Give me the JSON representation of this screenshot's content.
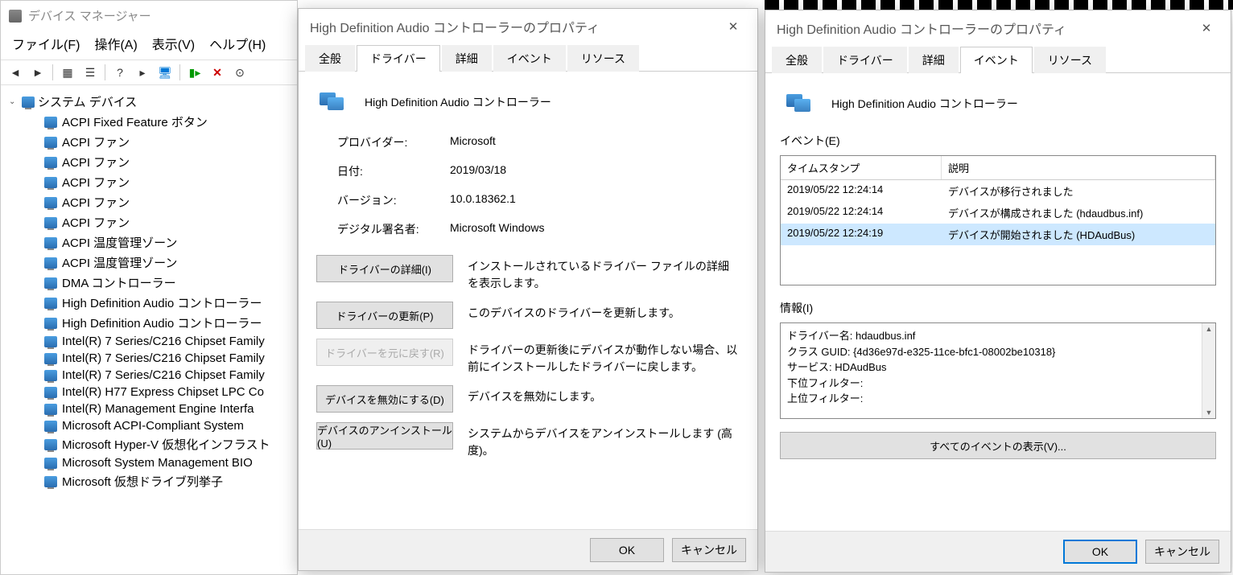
{
  "devmgr": {
    "title": "デバイス マネージャー",
    "menu": {
      "file": "ファイル(F)",
      "action": "操作(A)",
      "view": "表示(V)",
      "help": "ヘルプ(H)"
    },
    "root": "システム デバイス",
    "items": [
      "ACPI Fixed Feature ボタン",
      "ACPI ファン",
      "ACPI ファン",
      "ACPI ファン",
      "ACPI ファン",
      "ACPI ファン",
      "ACPI 温度管理ゾーン",
      "ACPI 温度管理ゾーン",
      "DMA コントローラー",
      "High Definition Audio コントローラー",
      "High Definition Audio コントローラー",
      "Intel(R) 7 Series/C216 Chipset Family",
      "Intel(R) 7 Series/C216 Chipset Family",
      "Intel(R) 7 Series/C216 Chipset Family",
      "Intel(R) H77 Express Chipset LPC Co",
      "Intel(R) Management Engine Interfa",
      "Microsoft ACPI-Compliant System",
      "Microsoft Hyper-V 仮想化インフラスト",
      "Microsoft System Management BIO",
      "Microsoft 仮想ドライブ列挙子"
    ]
  },
  "dlg1": {
    "title": "High Definition Audio コントローラーのプロパティ",
    "tabs": {
      "general": "全般",
      "driver": "ドライバー",
      "detail": "詳細",
      "event": "イベント",
      "resource": "リソース"
    },
    "device_name": "High Definition Audio コントローラー",
    "fields": {
      "provider_label": "プロバイダー:",
      "provider": "Microsoft",
      "date_label": "日付:",
      "date": "2019/03/18",
      "version_label": "バージョン:",
      "version": "10.0.18362.1",
      "signer_label": "デジタル署名者:",
      "signer": "Microsoft Windows"
    },
    "buttons": {
      "detail": "ドライバーの詳細(I)",
      "detail_desc": "インストールされているドライバー ファイルの詳細を表示します。",
      "update": "ドライバーの更新(P)",
      "update_desc": "このデバイスのドライバーを更新します。",
      "rollback": "ドライバーを元に戻す(R)",
      "rollback_desc": "ドライバーの更新後にデバイスが動作しない場合、以前にインストールしたドライバーに戻します。",
      "disable": "デバイスを無効にする(D)",
      "disable_desc": "デバイスを無効にします。",
      "uninstall": "デバイスのアンインストール(U)",
      "uninstall_desc": "システムからデバイスをアンインストールします (高度)。"
    },
    "ok": "OK",
    "cancel": "キャンセル"
  },
  "dlg2": {
    "title": "High Definition Audio コントローラーのプロパティ",
    "tabs": {
      "general": "全般",
      "driver": "ドライバー",
      "detail": "詳細",
      "event": "イベント",
      "resource": "リソース"
    },
    "device_name": "High Definition Audio コントローラー",
    "events_label": "イベント(E)",
    "evt_head": {
      "timestamp": "タイムスタンプ",
      "desc": "説明"
    },
    "events": [
      {
        "ts": "2019/05/22 12:24:14",
        "desc": "デバイスが移行されました"
      },
      {
        "ts": "2019/05/22 12:24:14",
        "desc": "デバイスが構成されました (hdaudbus.inf)"
      },
      {
        "ts": "2019/05/22 12:24:19",
        "desc": "デバイスが開始されました (HDAudBus)"
      }
    ],
    "info_label": "情報(I)",
    "info_lines": {
      "l1": "ドライバー名: hdaudbus.inf",
      "l2": "クラス GUID: {4d36e97d-e325-11ce-bfc1-08002be10318}",
      "l3": "サービス: HDAudBus",
      "l4": "下位フィルター:",
      "l5": "上位フィルター:"
    },
    "view_all": "すべてのイベントの表示(V)...",
    "ok": "OK",
    "cancel": "キャンセル"
  }
}
